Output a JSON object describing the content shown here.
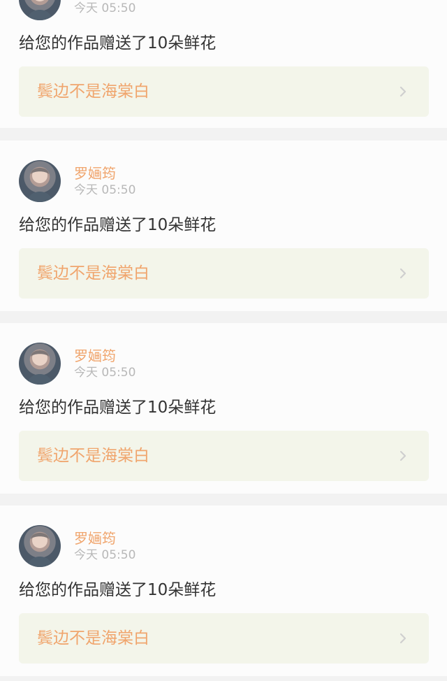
{
  "notifications": [
    {
      "user": "",
      "time": "今天 05:50",
      "message": "给您的作品赠送了10朵鲜花",
      "work_title": "鬓边不是海棠白"
    },
    {
      "user": "罗婳筠",
      "time": "今天 05:50",
      "message": "给您的作品赠送了10朵鲜花",
      "work_title": "鬓边不是海棠白"
    },
    {
      "user": "罗婳筠",
      "time": "今天 05:50",
      "message": "给您的作品赠送了10朵鲜花",
      "work_title": "鬓边不是海棠白"
    },
    {
      "user": "罗婳筠",
      "time": "今天 05:50",
      "message": "给您的作品赠送了10朵鲜花",
      "work_title": "鬓边不是海棠白"
    }
  ],
  "colors": {
    "accent_orange": "#f0a56d",
    "message_text": "#333333",
    "timestamp_gray": "#b8b8b8",
    "work_card_background": "#f3f5ea",
    "page_background": "#f2f2f2",
    "card_background": "#fcfcfc"
  },
  "icons": {
    "avatar": "user-avatar-icon",
    "chevron": "chevron-right-icon"
  }
}
